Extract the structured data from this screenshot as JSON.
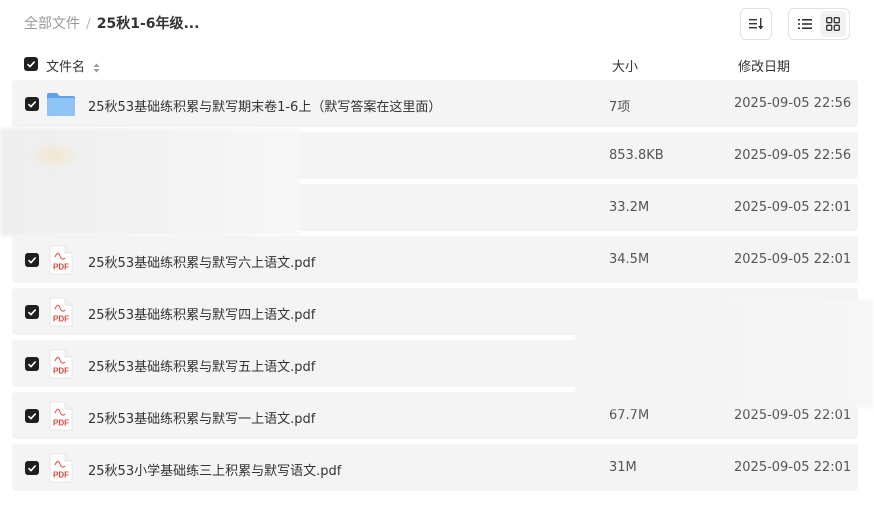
{
  "breadcrumb": {
    "root": "全部文件",
    "separator": "/",
    "current": "25秋1-6年级..."
  },
  "toolbar": {
    "sort_icon": "sort-icon",
    "list_view_icon": "list-view-icon",
    "grid_view_icon": "grid-view-icon",
    "active_view": "grid"
  },
  "table": {
    "headers": {
      "name": "文件名",
      "size": "大小",
      "date": "修改日期"
    },
    "rows": [
      {
        "type": "folder",
        "name": "25秋53基础练积累与默写期末卷1-6上（默写答案在这里面）",
        "size": "7项",
        "date": "2025-09-05 22:56",
        "checked": true
      },
      {
        "type": "obscured",
        "name": "",
        "size": "853.8KB",
        "date": "2025-09-05 22:56",
        "checked": false
      },
      {
        "type": "obscured",
        "name": "",
        "size": "33.2M",
        "date": "2025-09-05 22:01",
        "checked": false
      },
      {
        "type": "pdf",
        "name": "25秋53基础练积累与默写六上语文.pdf",
        "size": "34.5M",
        "date": "2025-09-05 22:01",
        "checked": true
      },
      {
        "type": "pdf",
        "name": "25秋53基础练积累与默写四上语文.pdf",
        "size": "",
        "date": "",
        "checked": true
      },
      {
        "type": "pdf",
        "name": "25秋53基础练积累与默写五上语文.pdf",
        "size": "",
        "date": "",
        "checked": true
      },
      {
        "type": "pdf",
        "name": "25秋53基础练积累与默写一上语文.pdf",
        "size": "67.7M",
        "date": "2025-09-05 22:01",
        "checked": true
      },
      {
        "type": "pdf",
        "name": "25秋53小学基础练三上积累与默写语文.pdf",
        "size": "31M",
        "date": "2025-09-05 22:01",
        "checked": true
      }
    ]
  },
  "colors": {
    "row_bg": "#f4f4f4",
    "checkbox": "#1f1f1f",
    "folder": "#6aa9ec",
    "pdf_red": "#e2453c"
  }
}
